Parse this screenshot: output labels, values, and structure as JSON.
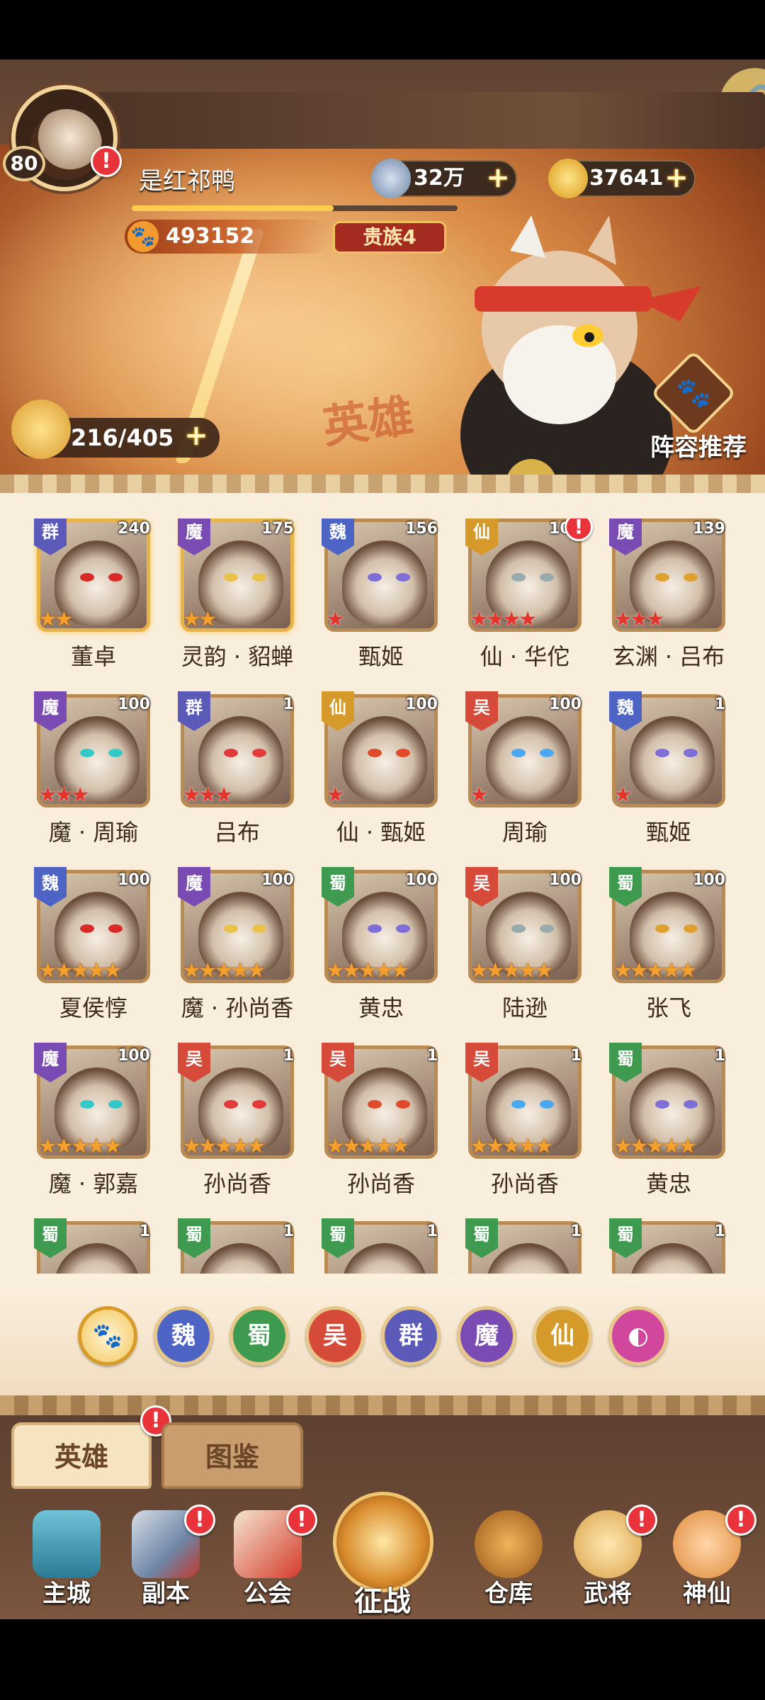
{
  "player": {
    "level": "80",
    "name": "是红祁鸭",
    "paw_points": "493152",
    "noble_rank": "贵族4",
    "exp_progress": 0.62
  },
  "currency": {
    "coins": "32万",
    "ingots": "37641"
  },
  "stamina": "216/405",
  "banner": {
    "title_art": "英雄",
    "lineup_label": "阵容推荐"
  },
  "alert_glyph": "!",
  "plus_glyph": "+",
  "heroes": [
    {
      "faction": "群",
      "level": "240",
      "stars": 2,
      "star_color": "gold",
      "name": "董卓",
      "alert": false
    },
    {
      "faction": "魔",
      "level": "175",
      "stars": 2,
      "star_color": "gold",
      "name": "灵韵 · 貂蝉",
      "alert": false
    },
    {
      "faction": "魏",
      "level": "156",
      "stars": 1,
      "star_color": "red",
      "name": "甄姬",
      "alert": false
    },
    {
      "faction": "仙",
      "level": "100",
      "stars": 4,
      "star_color": "red",
      "name": "仙 · 华佗",
      "alert": true
    },
    {
      "faction": "魔",
      "level": "139",
      "stars": 3,
      "star_color": "red",
      "name": "玄渊 · 吕布",
      "alert": false
    },
    {
      "faction": "魔",
      "level": "100",
      "stars": 3,
      "star_color": "red",
      "name": "魔 · 周瑜",
      "alert": false
    },
    {
      "faction": "群",
      "level": "1",
      "stars": 3,
      "star_color": "red",
      "name": "吕布",
      "alert": false
    },
    {
      "faction": "仙",
      "level": "100",
      "stars": 1,
      "star_color": "red",
      "name": "仙 · 甄姬",
      "alert": false
    },
    {
      "faction": "吴",
      "level": "100",
      "stars": 1,
      "star_color": "red",
      "name": "周瑜",
      "alert": false
    },
    {
      "faction": "魏",
      "level": "1",
      "stars": 1,
      "star_color": "red",
      "name": "甄姬",
      "alert": false
    },
    {
      "faction": "魏",
      "level": "100",
      "stars": 5,
      "star_color": "gold",
      "name": "夏侯惇",
      "alert": false
    },
    {
      "faction": "魔",
      "level": "100",
      "stars": 5,
      "star_color": "gold",
      "name": "魔 · 孙尚香",
      "alert": false
    },
    {
      "faction": "蜀",
      "level": "100",
      "stars": 5,
      "star_color": "gold",
      "name": "黄忠",
      "alert": false
    },
    {
      "faction": "吴",
      "level": "100",
      "stars": 5,
      "star_color": "gold",
      "name": "陆逊",
      "alert": false
    },
    {
      "faction": "蜀",
      "level": "100",
      "stars": 5,
      "star_color": "gold",
      "name": "张飞",
      "alert": false
    },
    {
      "faction": "魔",
      "level": "100",
      "stars": 5,
      "star_color": "gold",
      "name": "魔 · 郭嘉",
      "alert": false
    },
    {
      "faction": "吴",
      "level": "1",
      "stars": 5,
      "star_color": "gold",
      "name": "孙尚香",
      "alert": false
    },
    {
      "faction": "吴",
      "level": "1",
      "stars": 5,
      "star_color": "gold",
      "name": "孙尚香",
      "alert": false
    },
    {
      "faction": "吴",
      "level": "1",
      "stars": 5,
      "star_color": "gold",
      "name": "孙尚香",
      "alert": false
    },
    {
      "faction": "蜀",
      "level": "1",
      "stars": 5,
      "star_color": "gold",
      "name": "黄忠",
      "alert": false
    },
    {
      "faction": "蜀",
      "level": "1",
      "stars": 0,
      "star_color": "gold",
      "name": "",
      "alert": false
    },
    {
      "faction": "蜀",
      "level": "1",
      "stars": 0,
      "star_color": "gold",
      "name": "",
      "alert": false
    },
    {
      "faction": "蜀",
      "level": "1",
      "stars": 0,
      "star_color": "gold",
      "name": "",
      "alert": false
    },
    {
      "faction": "蜀",
      "level": "1",
      "stars": 0,
      "star_color": "gold",
      "name": "",
      "alert": false
    },
    {
      "faction": "蜀",
      "level": "1",
      "stars": 0,
      "star_color": "gold",
      "name": "",
      "alert": false
    }
  ],
  "faction_filters": [
    {
      "label": "🐾",
      "icon": "paw-icon",
      "selected": true
    },
    {
      "label": "魏"
    },
    {
      "label": "蜀"
    },
    {
      "label": "吴"
    },
    {
      "label": "群"
    },
    {
      "label": "魔"
    },
    {
      "label": "仙"
    },
    {
      "label": "◐",
      "icon": "fairy-swirl-icon"
    }
  ],
  "tabs": {
    "heroes": "英雄",
    "codex": "图鉴"
  },
  "nav": {
    "main_city": "主城",
    "dungeon": "副本",
    "guild": "公会",
    "battle": "征战",
    "warehouse": "仓库",
    "generals": "武将",
    "immortals": "神仙"
  },
  "colors": {
    "panel_bg": "#f9eedb",
    "banner_orange": "#d98a45",
    "alert_red": "#e8333a",
    "wei": "#4d64c4",
    "shu": "#3e9a4e",
    "wu": "#d64a3a",
    "qun": "#5b5ab8",
    "mo": "#7a4bb3",
    "xian": "#d59a2a"
  }
}
